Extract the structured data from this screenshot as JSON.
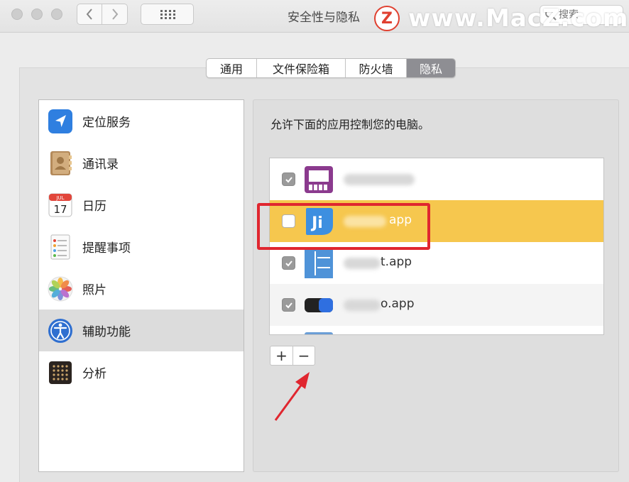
{
  "window": {
    "title": "安全性与隐私",
    "search_placeholder": "搜索",
    "nav_back_icon": "chevron-left-icon",
    "nav_forward_icon": "chevron-right-icon",
    "grid_icon": "show-all-grid-icon"
  },
  "watermark": {
    "logo": "Z",
    "text": "www.MacZ.com"
  },
  "tabs": [
    {
      "label": "通用",
      "active": false
    },
    {
      "label": "文件保险箱",
      "active": false
    },
    {
      "label": "防火墙",
      "active": false
    },
    {
      "label": "隐私",
      "active": true
    }
  ],
  "sidebar": {
    "selected": "辅助功能",
    "items": [
      {
        "label": "定位服务",
        "icon": "location-arrow-icon"
      },
      {
        "label": "通讯录",
        "icon": "contacts-book-icon"
      },
      {
        "label": "日历",
        "icon": "calendar-icon",
        "icon_month": "JUL",
        "icon_day": "17"
      },
      {
        "label": "提醒事项",
        "icon": "reminders-list-icon"
      },
      {
        "label": "照片",
        "icon": "photos-flower-icon"
      },
      {
        "label": "辅助功能",
        "icon": "accessibility-person-icon"
      },
      {
        "label": "分析",
        "icon": "analytics-dots-icon"
      }
    ]
  },
  "main": {
    "description": "允许下面的应用控制您的电脑。",
    "apps": [
      {
        "name_visible": "",
        "checked": true,
        "highlighted": false,
        "icon": "keynote-purple-icon"
      },
      {
        "name_visible": "app",
        "checked": false,
        "highlighted": true,
        "icon": "jietu-ji-icon",
        "icon_text": "Ji"
      },
      {
        "name_visible": "t.app",
        "checked": true,
        "highlighted": false,
        "icon": "split-window-icon"
      },
      {
        "name_visible": "o.app",
        "checked": true,
        "highlighted": false,
        "icon": "toggle-app-icon"
      }
    ],
    "add_label": "+",
    "remove_label": "−"
  },
  "colors": {
    "highlight_row": "#f6c74e",
    "annotation_red": "#e0262f",
    "active_tab": "#8e8e93"
  }
}
